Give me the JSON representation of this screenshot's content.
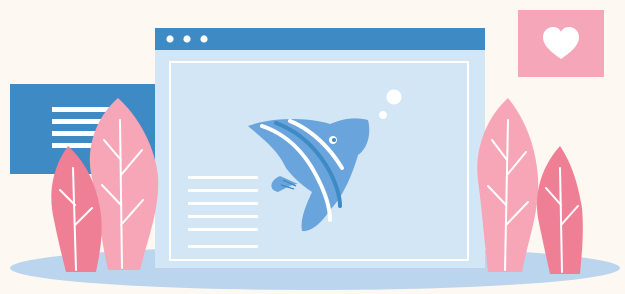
{
  "colors": {
    "background": "#fdf8f1",
    "window_bar": "#3e8ac5",
    "window_body": "#d3e6f6",
    "panel_blue": "#3e8ac5",
    "fish": "#6aa4dc",
    "heart_card": "#f5a7b9",
    "leaf_light": "#f6a6b6",
    "leaf_dark": "#ef7f95",
    "ground": "#bcd5ee"
  },
  "icons": {
    "heart": "heart-icon",
    "fish": "fish-icon",
    "window_dots": "window-dots-icon"
  }
}
